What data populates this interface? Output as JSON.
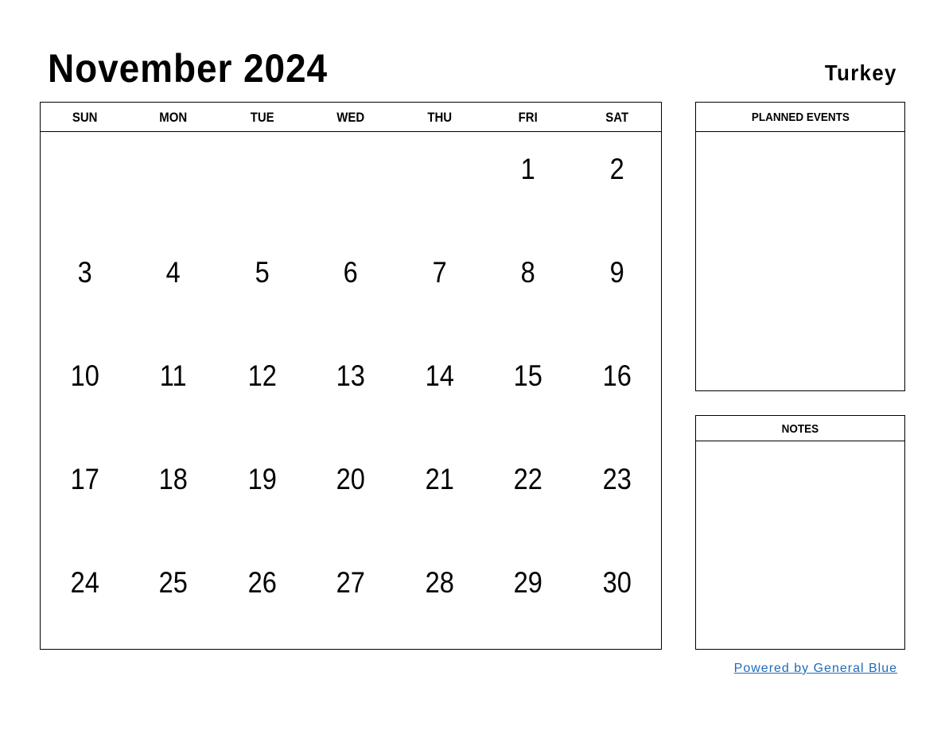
{
  "header": {
    "title": "November 2024",
    "country": "Turkey"
  },
  "calendar": {
    "weekdays": [
      "SUN",
      "MON",
      "TUE",
      "WED",
      "THU",
      "FRI",
      "SAT"
    ],
    "cells": [
      "",
      "",
      "",
      "",
      "",
      "1",
      "2",
      "3",
      "4",
      "5",
      "6",
      "7",
      "8",
      "9",
      "10",
      "11",
      "12",
      "13",
      "14",
      "15",
      "16",
      "17",
      "18",
      "19",
      "20",
      "21",
      "22",
      "23",
      "24",
      "25",
      "26",
      "27",
      "28",
      "29",
      "30"
    ]
  },
  "planned_events": {
    "title": "PLANNED EVENTS"
  },
  "notes": {
    "title": "NOTES"
  },
  "footer": {
    "powered_by": "Powered by General Blue",
    "link_color": "#1f6bb8"
  }
}
